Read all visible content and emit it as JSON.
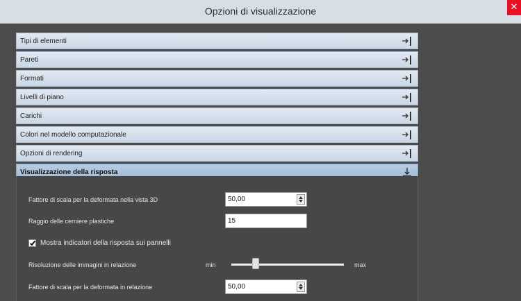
{
  "window": {
    "title": "Opzioni di visualizzazione",
    "close_glyph": "✕"
  },
  "sections": [
    {
      "label": "Tipi di elementi",
      "icon": "expand-arrow-icon"
    },
    {
      "label": "Pareti",
      "icon": "expand-arrow-icon"
    },
    {
      "label": "Formati",
      "icon": "expand-arrow-icon"
    },
    {
      "label": "Livelli di piano",
      "icon": "expand-arrow-icon"
    },
    {
      "label": "Carichi",
      "icon": "expand-arrow-icon"
    },
    {
      "label": "Colori nel modello computazionale",
      "icon": "expand-arrow-icon"
    },
    {
      "label": "Opzioni di rendering",
      "icon": "expand-arrow-icon"
    },
    {
      "label": "Visualizzazione della risposta",
      "icon": "collapse-arrow-icon",
      "expanded": true
    }
  ],
  "response_panel": {
    "deform_scale_3d_label": "Fattore di scala per la deformata nella vista 3D",
    "deform_scale_3d_value": "50,00",
    "plastic_hinge_radius_label": "Raggio delle cerniere plastiche",
    "plastic_hinge_radius_value": "15",
    "show_indicators_label": "Mostra indicatori della risposta sui pannelli",
    "show_indicators_checked": true,
    "image_resolution_label": "Risoluzione delle immagini in relazione",
    "slider_min_label": "min",
    "slider_max_label": "max",
    "slider_level": 0.2,
    "deform_scale_report_label": "Fattore di scala per la deformata in relazione",
    "deform_scale_report_value": "50,00"
  },
  "colors": {
    "titlebar": "#d8dee6",
    "close": "#e81123",
    "panel_bg": "#474747",
    "header_expanded": "#a9c0dc"
  }
}
